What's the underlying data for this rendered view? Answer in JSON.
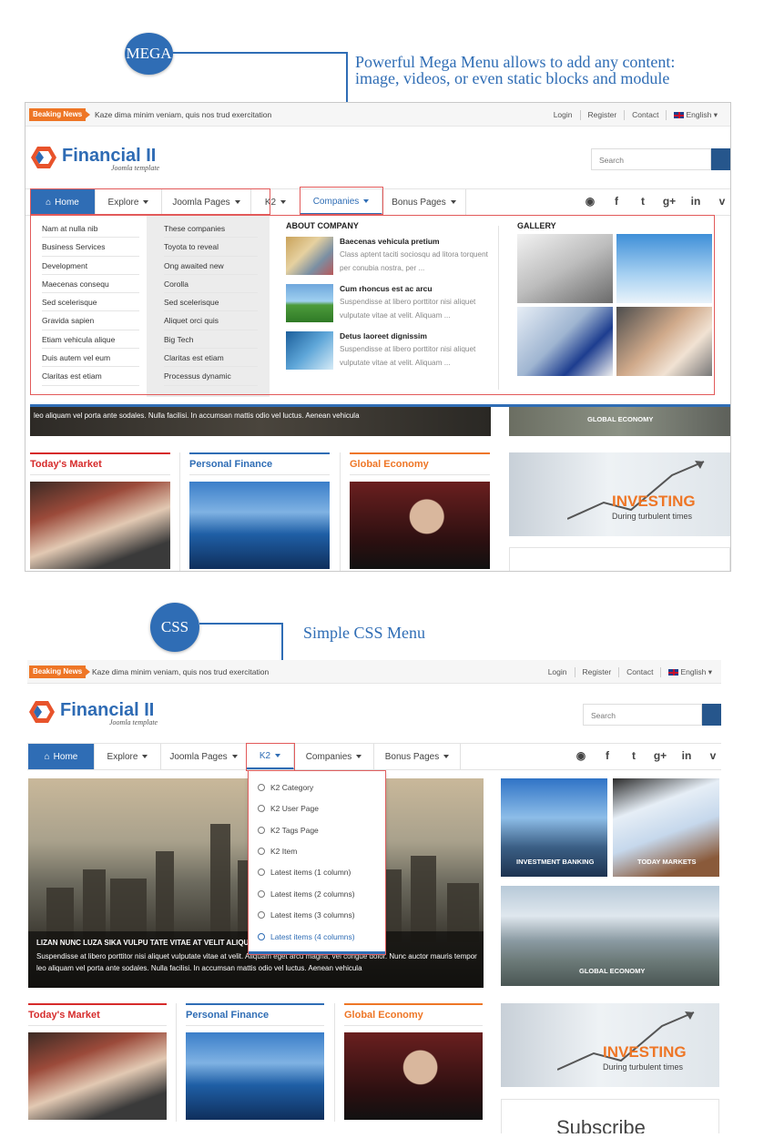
{
  "annotations": {
    "mega_bubble": "MEGA",
    "mega_text_line1": "Powerful Mega Menu allows to add any content:",
    "mega_text_line2": "image, videos, or even static blocks and module",
    "css_bubble": "CSS",
    "css_text": "Simple CSS Menu"
  },
  "colors": {
    "accent": "#2f6db5",
    "breaking": "#ee7626",
    "highlight": "#e25a5a",
    "market": "#d62b2b",
    "finance": "#2f6db5",
    "economy": "#ee7626"
  },
  "site": {
    "breaking_label": "Beaking News",
    "ticker": "Kaze dima minim veniam, quis nos trud exercitation",
    "top_links": [
      "Login",
      "Register",
      "Contact"
    ],
    "language": "English",
    "logo_name": "Financial II",
    "logo_sub": "Joomla template",
    "search_placeholder": "Search",
    "nav": [
      "Home",
      "Explore",
      "Joomla Pages",
      "K2",
      "Companies",
      "Bonus Pages"
    ],
    "social_icons": [
      "rss-icon",
      "facebook-icon",
      "twitter-icon",
      "google-plus-icon",
      "linkedin-icon",
      "vimeo-icon"
    ]
  },
  "mega_menu": {
    "col1": [
      "Nam at nulla nib",
      "Business Services",
      "Development",
      "Maecenas consequ",
      "Sed scelerisque",
      "Gravida sapien",
      "Etiam vehicula alique",
      "Duis autem vel eum",
      "Claritas est etiam"
    ],
    "col2": [
      "These companies",
      "Toyota to reveal",
      "Ong awaited new",
      "Corolla",
      "Sed scelerisque",
      "Aliquet orci quis",
      "Big Tech",
      "Claritas est etiam",
      "Processus dynamic"
    ],
    "about_heading": "ABOUT COMPANY",
    "articles": [
      {
        "title": "Baecenas vehicula pretium",
        "text": "Class aptent taciti sociosqu ad litora torquent per conubia nostra, per ..."
      },
      {
        "title": "Cum rhoncus est ac arcu",
        "text": "Suspendisse at libero porttitor nisi aliquet vulputate vitae at velit. Aliquam ..."
      },
      {
        "title": "Detus laoreet dignissim",
        "text": "Suspendisse at libero porttitor nisi aliquet vulputate vitae at velit. Aliquam ..."
      }
    ],
    "gallery_heading": "GALLERY"
  },
  "top_shot": {
    "slider_caption": "leo aliquam vel porta ante sodales. Nulla facilisi. In accumsan mattis odio vel luctus. Aenean vehicula",
    "global_economy": "GLOBAL ECONOMY",
    "sections": [
      "Today's Market",
      "Personal Finance",
      "Global Economy"
    ],
    "investing_title": "INVESTING",
    "investing_sub": "During turbulent times"
  },
  "k2_dropdown": [
    "K2 Category",
    "K2 User Page",
    "K2 Tags Page",
    "K2 Item",
    "Latest items (1 column)",
    "Latest items (2 columns)",
    "Latest items (3 columns)",
    "Latest items (4 columns)"
  ],
  "bottom_shot": {
    "slider_title": "LIZAN NUNC LUZA SIKA VULPU TATE VITAE AT VELIT ALIQUAM",
    "slider_text_1": "Suspendisse at libero porttitor nisi aliquet vulputate vitae at velit. Aliquam eget arcu magna, vel congue dolor. Nunc auctor mauris tempor",
    "slider_text_2": "leo aliquam vel porta ante sodales. Nulla facilisi. In accumsan mattis odio vel luctus. Aenean vehicula",
    "tiles": [
      "INVESTMENT BANKING",
      "TODAY MARKETS",
      "GLOBAL ECONOMY"
    ],
    "sections": [
      "Today's Market",
      "Personal Finance",
      "Global Economy"
    ],
    "investing_title": "INVESTING",
    "investing_sub": "During turbulent times",
    "subscribe_partial": "Subscribe"
  }
}
